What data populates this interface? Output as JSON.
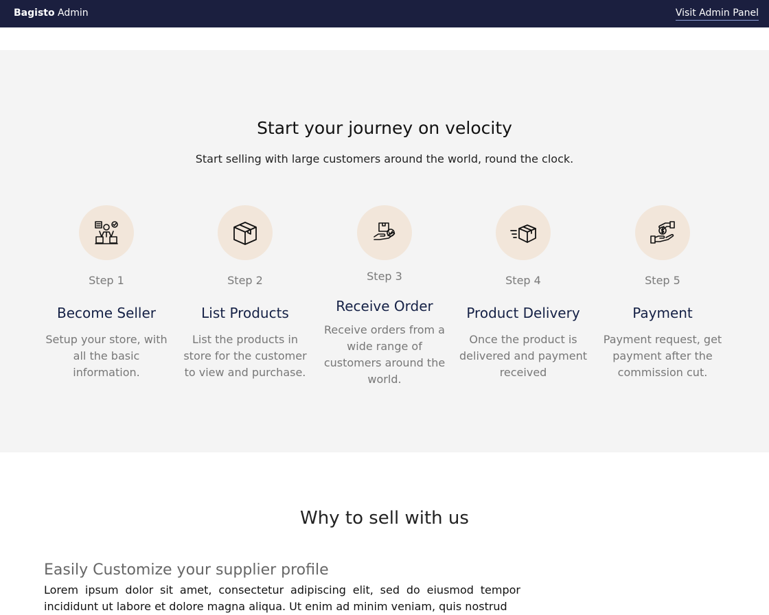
{
  "header": {
    "brand_bold": "Bagisto",
    "brand_light": "Admin",
    "visit_link": "Visit Admin Panel",
    "bg_color": "#1b1f3f"
  },
  "journey": {
    "title": "Start your journey on velocity",
    "subtitle": "Start selling with large customers around the world, round the clock.",
    "steps": [
      {
        "icon": "seller-icon",
        "step": "Step 1",
        "title": "Become Seller",
        "desc": "Setup your store, with all the basic information."
      },
      {
        "icon": "box-icon",
        "step": "Step 2",
        "title": "List Products",
        "desc": "List the products in store for the customer to view and purchase."
      },
      {
        "icon": "order-icon",
        "step": "Step 3",
        "title": "Receive Order",
        "desc": "Receive orders from a wide range of customers around the world."
      },
      {
        "icon": "delivery-icon",
        "step": "Step 4",
        "title": "Product Delivery",
        "desc": "Once the product is delivered and payment received"
      },
      {
        "icon": "payment-icon",
        "step": "Step 5",
        "title": "Payment",
        "desc": "Payment request, get payment after the commission cut."
      }
    ]
  },
  "why": {
    "title": "Why to sell with us",
    "feature_title": "Easily Customize your supplier profile",
    "feature_text": "Lorem ipsum dolor sit amet, consectetur adipiscing elit, sed do eiusmod tempor incididunt ut labore et dolore magna aliqua. Ut enim ad minim veniam, quis nostrud"
  }
}
